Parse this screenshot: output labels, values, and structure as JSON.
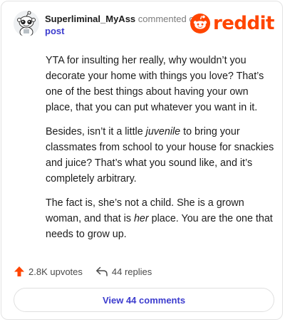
{
  "comment": {
    "username": "Superliminal_MyAss",
    "action_text": "commented on",
    "post_link": "post",
    "brand": "reddit",
    "paragraphs": [
      {
        "segments": [
          {
            "text": "YTA for insulting her really, why wouldn’t you decorate your home with things you love? That’s one of the best things about having your own place, that you can put whatever you want in it.",
            "italic": false
          }
        ]
      },
      {
        "segments": [
          {
            "text": "Besides, isn’t it a little ",
            "italic": false
          },
          {
            "text": "juvenile",
            "italic": true
          },
          {
            "text": " to bring your classmates from school to your house for snackies and juice? That’s what you sound like, and it’s completely arbitrary.",
            "italic": false
          }
        ]
      },
      {
        "segments": [
          {
            "text": "The fact is, she’s not a child. She is a grown woman, and that is ",
            "italic": false
          },
          {
            "text": "her",
            "italic": true
          },
          {
            "text": " place. You are the one that needs to grow up.",
            "italic": false
          }
        ]
      }
    ],
    "upvotes": "2.8K upvotes",
    "replies": "44 replies",
    "view_comments": "View 44 comments"
  },
  "icons": {
    "avatar": "snoo-avatar-icon",
    "logo": "reddit-logo-icon",
    "upvote": "upvote-arrow-icon",
    "reply": "reply-arrow-icon"
  },
  "colors": {
    "brand": "#ff4500",
    "link": "#3c3cce",
    "text": "#1c1c1c",
    "muted": "#7c7c7c"
  }
}
